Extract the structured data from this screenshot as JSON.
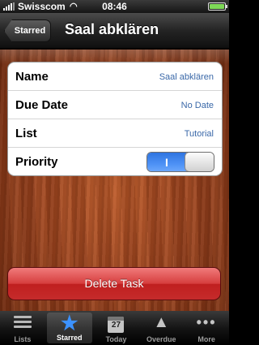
{
  "status_bar": {
    "carrier": "Swisscom",
    "time": "08:46",
    "wifi_icon": "wifi-icon",
    "battery_icon": "battery-icon"
  },
  "nav_bar": {
    "back_label": "Starred",
    "title": "Saal abklären"
  },
  "task": {
    "rows": [
      {
        "label": "Name",
        "value": "Saal abklären"
      },
      {
        "label": "Due Date",
        "value": "No Date"
      },
      {
        "label": "List",
        "value": "Tutorial"
      },
      {
        "label": "Priority",
        "toggle_on": true,
        "toggle_text": "I"
      }
    ]
  },
  "actions": {
    "delete_label": "Delete Task",
    "delete_color": "#d63d3d"
  },
  "tab_bar": {
    "tabs": [
      {
        "label": "Lists",
        "icon": "lists-icon"
      },
      {
        "label": "Starred",
        "icon": "star-icon",
        "active": true
      },
      {
        "label": "Today",
        "icon": "calendar-icon",
        "badge": "27"
      },
      {
        "label": "Overdue",
        "icon": "warning-icon"
      },
      {
        "label": "More",
        "icon": "more-icon"
      }
    ]
  },
  "colors": {
    "accent_blue": "#3c92ff",
    "value_text": "#3a68a8",
    "toggle_blue": "#2f74e0"
  }
}
